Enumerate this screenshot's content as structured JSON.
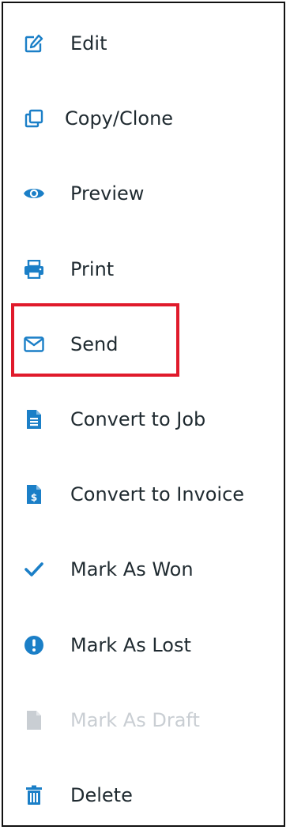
{
  "menu": {
    "items": [
      {
        "label": "Edit",
        "icon": "edit-icon",
        "enabled": true
      },
      {
        "label": "Copy/Clone",
        "icon": "copy-icon",
        "enabled": true
      },
      {
        "label": "Preview",
        "icon": "eye-icon",
        "enabled": true
      },
      {
        "label": "Print",
        "icon": "printer-icon",
        "enabled": true
      },
      {
        "label": "Send",
        "icon": "envelope-icon",
        "enabled": true,
        "highlighted": true
      },
      {
        "label": "Convert to Job",
        "icon": "document-icon",
        "enabled": true
      },
      {
        "label": "Convert to Invoice",
        "icon": "invoice-dollar-icon",
        "enabled": true
      },
      {
        "label": "Mark As Won",
        "icon": "checkmark-icon",
        "enabled": true
      },
      {
        "label": "Mark As Lost",
        "icon": "exclamation-circle-icon",
        "enabled": true
      },
      {
        "label": "Mark As Draft",
        "icon": "file-icon",
        "enabled": false
      },
      {
        "label": "Delete",
        "icon": "trash-icon",
        "enabled": true
      }
    ]
  },
  "colors": {
    "icon": "#1b7fc7",
    "text": "#1f2a30",
    "disabled": "#c9ced3",
    "highlight_border": "#e01a2b",
    "menu_border": "#111111"
  }
}
